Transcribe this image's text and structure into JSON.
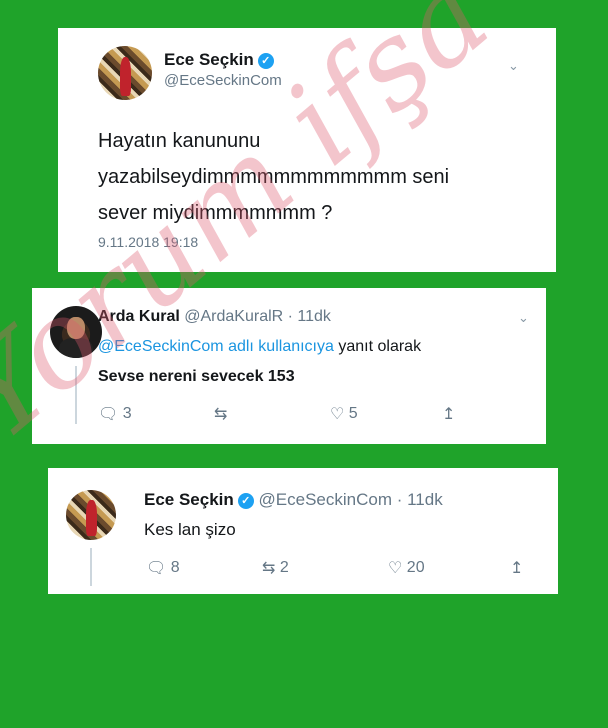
{
  "tweet1": {
    "name": "Ece Seçkin",
    "handle": "@EceSeckinCom",
    "lines": [
      "Hayatın kanununu",
      "yazabilseydimmmmmmmmmmmm seni",
      "sever miydimmmmmmm ?"
    ],
    "timestamp": "9.11.2018 19:18"
  },
  "tweet2": {
    "name": "Arda Kural",
    "handle": "@ArdaKuralR · 11dk",
    "reply_mention": "@EceSeckinCom adlı kullanıcıya",
    "reply_suffix": " yanıt olarak",
    "text": "Sevse nereni sevecek 153",
    "replies": "3",
    "retweets": "",
    "likes": "5"
  },
  "tweet3": {
    "name": "Ece Seçkin",
    "handle": "@EceSeckinCom · 11dk",
    "text": "Kes lan şizo",
    "replies": "8",
    "retweets": "2",
    "likes": "20"
  },
  "watermark": "Yorum ifşa",
  "colors": {
    "background": "#1fa32a",
    "verified": "#1da1f2",
    "mention": "#1b95e0"
  },
  "icons": [
    "verified-badge-icon",
    "chevron-down-icon",
    "reply-icon",
    "retweet-icon",
    "like-icon",
    "share-icon"
  ]
}
